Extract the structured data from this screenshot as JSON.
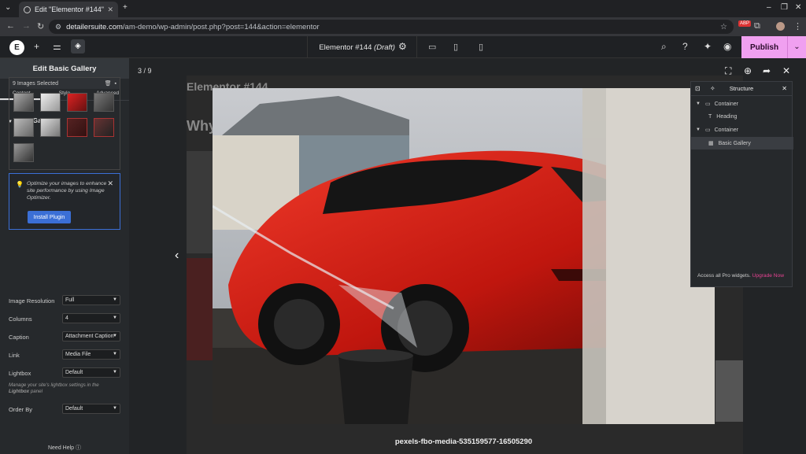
{
  "browser": {
    "tab_title": "Edit \"Elementor #144\" ‹",
    "url_host": "detailersuite.com",
    "url_path": "/am-demo/wp-admin/post.php?post=144&action=elementor"
  },
  "topbar": {
    "doc_title": "Elementor #144",
    "doc_status": "(Draft)",
    "publish_label": "Publish"
  },
  "panel": {
    "title": "Edit Basic Gallery",
    "tabs": [
      {
        "label": "Content",
        "icon": "pencil-icon"
      },
      {
        "label": "Style",
        "icon": "half-circle-icon"
      },
      {
        "label": "Advanced",
        "icon": "gear-icon"
      }
    ],
    "section_title": "Basic Gallery",
    "images_selected": "9 Images Selected",
    "notice_text": "Optimize your images to enhance site performance by using Image Optimizer.",
    "install_label": "Install Plugin",
    "controls": [
      {
        "label": "Image Resolution",
        "value": "Full"
      },
      {
        "label": "Columns",
        "value": "4"
      },
      {
        "label": "Caption",
        "value": "Attachment Caption"
      },
      {
        "label": "Link",
        "value": "Media File"
      },
      {
        "label": "Lightbox",
        "value": "Default"
      },
      {
        "label": "Order By",
        "value": "Default"
      }
    ],
    "lightbox_note_pre": "Manage your site's lightbox settings in the ",
    "lightbox_note_link": "Lightbox",
    "lightbox_note_post": " panel",
    "need_help": "Need Help"
  },
  "canvas": {
    "heading_text": "Elementor #144",
    "sub_text": "Why"
  },
  "lightbox": {
    "counter": "3 / 9",
    "caption": "pexels-fbo-media-535159577-16505290"
  },
  "structure": {
    "title": "Structure",
    "rows": [
      {
        "label": "Container",
        "level": 0
      },
      {
        "label": "Heading",
        "level": 1
      },
      {
        "label": "Container",
        "level": 0
      },
      {
        "label": "Basic Gallery",
        "level": 1
      }
    ],
    "upgrade_text": "Access all Pro widgets.",
    "upgrade_link": "Upgrade Now"
  }
}
